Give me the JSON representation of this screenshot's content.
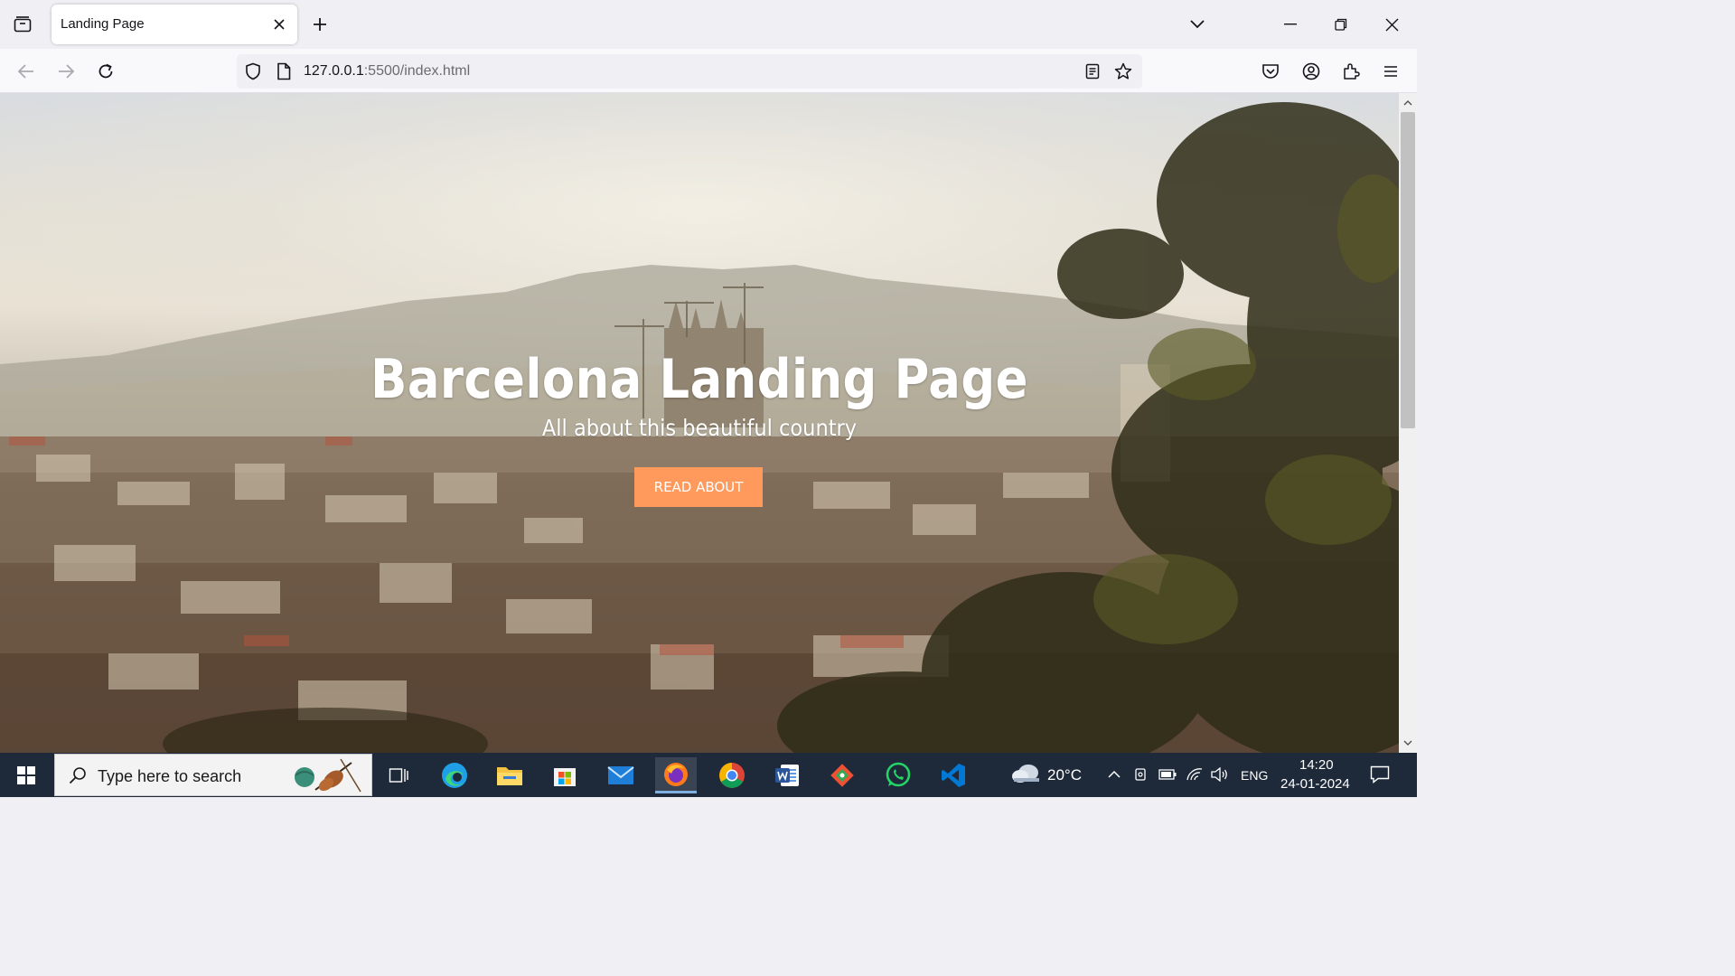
{
  "browser": {
    "tab": {
      "title": "Landing Page"
    },
    "url": {
      "host": "127.0.0.1",
      "rest": ":5500/index.html"
    }
  },
  "page": {
    "hero_title": "Barcelona Landing Page",
    "hero_subtitle": "All about this beautiful country",
    "cta_label": "READ ABOUT"
  },
  "taskbar": {
    "search_placeholder": "Type here to search",
    "weather": "20°C",
    "language": "ENG",
    "time": "14:20",
    "date": "24-01-2024"
  },
  "colors": {
    "cta": "#ff9a5c",
    "taskbar": "#1e2a3a"
  },
  "icons": {
    "tab_list": "tab-list-icon",
    "close_tab": "close-icon",
    "new_tab": "plus-icon",
    "back": "arrow-left-icon",
    "forward": "arrow-right-icon",
    "reload": "reload-icon",
    "shield": "shield-icon",
    "page": "page-icon",
    "reader": "reader-view-icon",
    "bookmark": "star-icon",
    "pocket": "pocket-icon",
    "account": "account-icon",
    "extensions": "extensions-icon",
    "menu": "hamburger-menu-icon"
  }
}
